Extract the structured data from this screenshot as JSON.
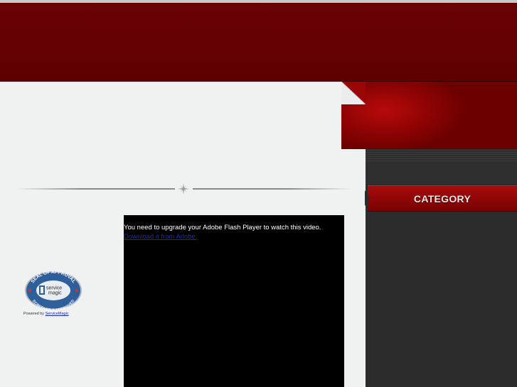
{
  "sidebar": {
    "category_label": "CATEGORY"
  },
  "video": {
    "flash_message": "You need to upgrade your Adobe Flash Player to watch this video.",
    "flash_link": "Download it from Adobe."
  },
  "badge": {
    "seal_top_text": "SEAL OF APPROVAL",
    "seal_brand_line1": "service",
    "seal_brand_line2": "magic",
    "seal_bottom_text": "SCREENED & APPROVED",
    "powered_prefix": "Powered by",
    "powered_link": "ServiceMagic"
  },
  "colors": {
    "header_red": "#640101",
    "accent_red": "#a70d0d",
    "sidebar_dark": "#2c2c2c",
    "content_bg": "#f0f1f1",
    "link_blue": "#1a2bb8"
  },
  "icons": {
    "divider": "compass-star-icon",
    "seal": "service-magic-seal-icon"
  }
}
